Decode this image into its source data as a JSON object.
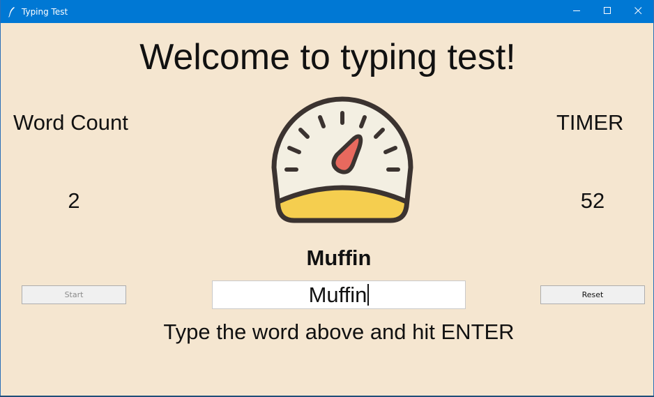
{
  "window": {
    "title": "Typing Test",
    "icon": "feather-icon",
    "controls": [
      "minimize-icon",
      "maximize-icon",
      "close-icon"
    ]
  },
  "main": {
    "heading": "Welcome to typing test!",
    "word_count_label": "Word Count",
    "word_count_value": "2",
    "timer_label": "TIMER",
    "timer_value": "52",
    "gauge_icon": "speedometer-icon",
    "current_word": "Muffin",
    "entry_value": "Muffin",
    "start_label": "Start",
    "reset_label": "Reset",
    "instruction": "Type the word above and hit ENTER"
  },
  "colors": {
    "background": "#f5e6d0",
    "titlebar": "#0078d4",
    "gauge_face": "#f3efe2",
    "gauge_fill": "#f5ce4f",
    "gauge_needle": "#e8695e",
    "gauge_outline": "#3b3330"
  }
}
